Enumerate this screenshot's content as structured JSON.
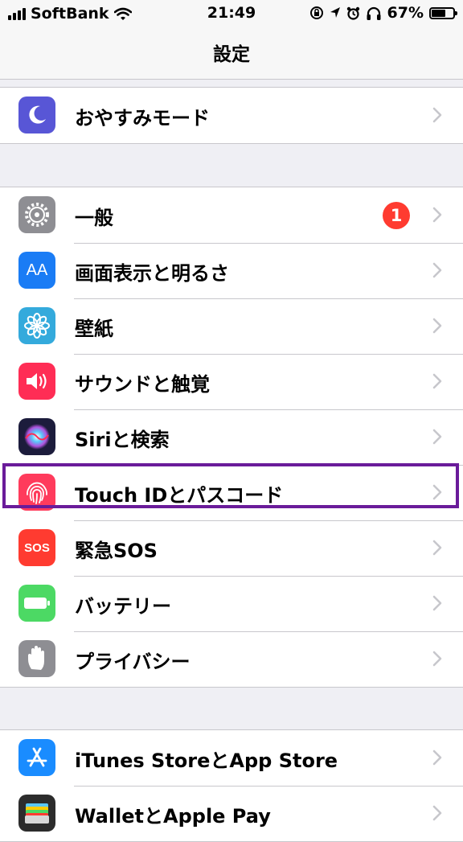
{
  "status_bar": {
    "carrier": "SoftBank",
    "time": "21:49",
    "battery_percent": "67%",
    "battery_level": 0.67,
    "icons": [
      "signal-icon",
      "wifi-icon",
      "rotation-lock-icon",
      "location-icon",
      "alarm-icon",
      "headphones-icon",
      "battery-icon"
    ]
  },
  "nav": {
    "title": "設定"
  },
  "groups": [
    {
      "rows": [
        {
          "label": "おやすみモード",
          "icon": "moon-icon",
          "color": "#5856d6"
        }
      ]
    },
    {
      "rows": [
        {
          "label": "一般",
          "icon": "gear-icon",
          "color": "#8e8e93",
          "badge": "1"
        },
        {
          "label": "画面表示と明るさ",
          "icon": "text-size-icon",
          "color": "#1a7cf5",
          "icon_text": "AA"
        },
        {
          "label": "壁紙",
          "icon": "flower-icon",
          "color": "#34aadc"
        },
        {
          "label": "サウンドと触覚",
          "icon": "speaker-icon",
          "color": "#ff2d55"
        },
        {
          "label": "Siriと検索",
          "icon": "siri-icon",
          "color": "#1c1c3c"
        },
        {
          "label": "Touch IDとパスコード",
          "icon": "fingerprint-icon",
          "color": "#ff3b5c"
        },
        {
          "label": "緊急SOS",
          "icon": "sos-icon",
          "color": "#ff3b30",
          "icon_text": "SOS"
        },
        {
          "label": "バッテリー",
          "icon": "battery-setting-icon",
          "color": "#4cd964"
        },
        {
          "label": "プライバシー",
          "icon": "hand-icon",
          "color": "#8e8e93"
        }
      ]
    },
    {
      "rows": [
        {
          "label": "iTunes StoreとApp Store",
          "icon": "app-store-icon",
          "color": "#1a8cff"
        },
        {
          "label": "WalletとApple Pay",
          "icon": "wallet-icon",
          "color": "#2c2c2c"
        }
      ]
    }
  ],
  "highlight_color": "#6a1b9a"
}
